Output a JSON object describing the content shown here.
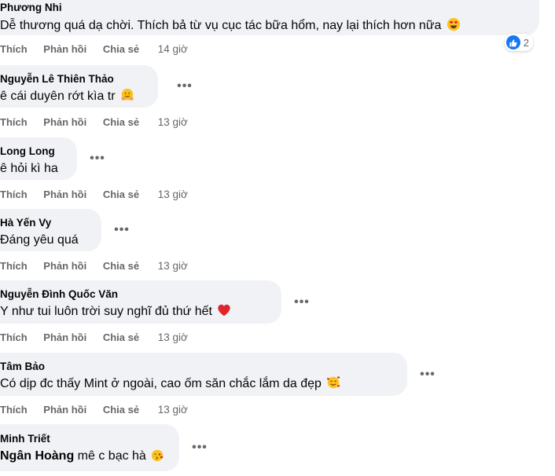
{
  "comments": [
    {
      "author": "Phương Nhi",
      "text": "Dễ thương quá dạ chời. Thích bả từ vụ cục tác bữa hổm, nay lại thích hơn nữa",
      "emoji": "heart-eyes-emoji",
      "reaction_count": "2",
      "actions": {
        "like": "Thích",
        "reply": "Phản hồi",
        "share": "Chia sẻ",
        "time": "14 giờ"
      }
    },
    {
      "author": "Nguyễn Lê Thiên Thảo",
      "text": "ê cái duyên rớt kìa tr",
      "emoji": "hugging-face-emoji",
      "actions": {
        "like": "Thích",
        "reply": "Phản hồi",
        "share": "Chia sẻ",
        "time": "13 giờ"
      }
    },
    {
      "author": "Long Long",
      "text": "ê hỏi kì ha",
      "actions": {
        "like": "Thích",
        "reply": "Phản hồi",
        "share": "Chia sẻ",
        "time": "13 giờ"
      }
    },
    {
      "author": "Hà Yến Vy",
      "text": "Đáng yêu quá",
      "actions": {
        "like": "Thích",
        "reply": "Phản hồi",
        "share": "Chia sẻ",
        "time": "13 giờ"
      }
    },
    {
      "author": "Nguyễn Đình Quốc Văn",
      "text": "Y như tui luôn trời suy nghĩ đủ thứ hết",
      "emoji": "red-heart-emoji",
      "actions": {
        "like": "Thích",
        "reply": "Phản hồi",
        "share": "Chia sẻ",
        "time": "13 giờ"
      }
    },
    {
      "author": "Tâm Bảo",
      "text": "Có dịp đc thấy Mint ở ngoài, cao ốm săn chắc lắm da đẹp",
      "emoji": "smiling-face-with-hearts-emoji",
      "actions": {
        "like": "Thích",
        "reply": "Phản hồi",
        "share": "Chia sẻ",
        "time": "13 giờ"
      }
    },
    {
      "author": "Minh Triết",
      "mention": "Ngân Hoàng",
      "text": "mê c bạc hà",
      "emoji": "face-blowing-kiss-emoji"
    }
  ]
}
